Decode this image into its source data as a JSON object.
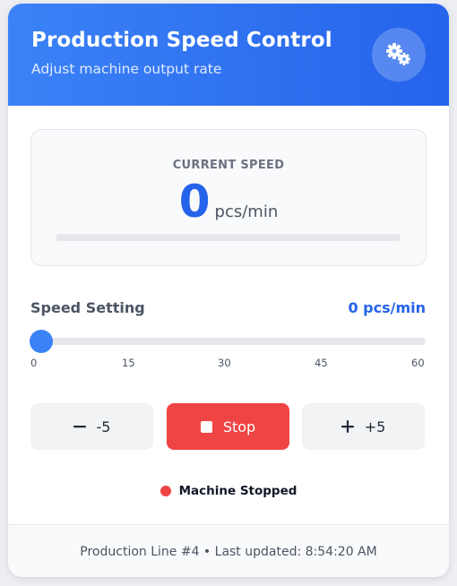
{
  "header": {
    "title": "Production Speed Control",
    "subtitle": "Adjust machine output rate",
    "settings_icon": "gears-icon"
  },
  "current_speed": {
    "label": "CURRENT SPEED",
    "value": "0",
    "unit": "pcs/min",
    "bar_fill_fraction": 0
  },
  "speed_setting": {
    "label": "Speed Setting",
    "value_text": "0 pcs/min",
    "value": 0,
    "min": 0,
    "max": 60,
    "ticks": [
      "0",
      "15",
      "30",
      "45",
      "60"
    ]
  },
  "controls": {
    "decrease": {
      "label": "-5",
      "icon": "minus-icon"
    },
    "stop": {
      "label": "Stop",
      "icon": "stop-square-icon"
    },
    "increase": {
      "label": "+5",
      "icon": "plus-icon"
    }
  },
  "status": {
    "text": "Machine Stopped",
    "color": "#ef4444"
  },
  "footer": {
    "text": "Production Line #4 • Last updated: 8:54:20 AM"
  },
  "colors": {
    "accent": "#2563eb",
    "accent_light": "#3b82f6",
    "stop": "#ef4444"
  }
}
